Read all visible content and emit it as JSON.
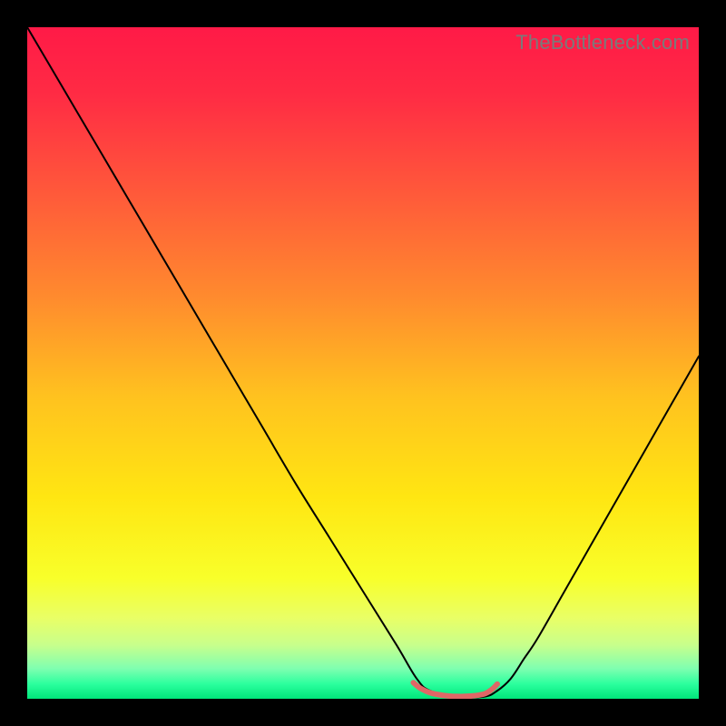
{
  "watermark": "TheBottleneck.com",
  "chart_data": {
    "type": "line",
    "title": "",
    "xlabel": "",
    "ylabel": "",
    "xlim": [
      0,
      100
    ],
    "ylim": [
      0,
      100
    ],
    "grid": false,
    "legend": false,
    "gradient_stops": [
      {
        "offset": 0.0,
        "color": "#ff1a47"
      },
      {
        "offset": 0.1,
        "color": "#ff2b44"
      },
      {
        "offset": 0.25,
        "color": "#ff5a3a"
      },
      {
        "offset": 0.4,
        "color": "#ff8a2e"
      },
      {
        "offset": 0.55,
        "color": "#ffc21f"
      },
      {
        "offset": 0.7,
        "color": "#ffe612"
      },
      {
        "offset": 0.82,
        "color": "#f8ff2a"
      },
      {
        "offset": 0.88,
        "color": "#e9ff66"
      },
      {
        "offset": 0.92,
        "color": "#c8ff8c"
      },
      {
        "offset": 0.955,
        "color": "#7fffb0"
      },
      {
        "offset": 0.978,
        "color": "#2bff9e"
      },
      {
        "offset": 1.0,
        "color": "#00e67a"
      }
    ],
    "series": [
      {
        "name": "bottleneck-curve",
        "color": "#000000",
        "width": 2,
        "x": [
          0,
          5,
          10,
          15,
          20,
          25,
          30,
          35,
          40,
          45,
          50,
          55,
          58,
          60,
          64,
          68,
          70,
          72,
          74,
          76,
          80,
          84,
          88,
          92,
          96,
          100
        ],
        "y": [
          100,
          91.5,
          83,
          74.5,
          66,
          57.5,
          49,
          40.5,
          32,
          24,
          16,
          8,
          3,
          1.2,
          0.3,
          0.3,
          1.2,
          3,
          6,
          9,
          16,
          23,
          30,
          37,
          44,
          51
        ]
      },
      {
        "name": "sweet-spot-band",
        "color": "#e06666",
        "width": 6,
        "x": [
          57.5,
          58.5,
          60,
          62,
          64,
          66,
          68,
          69.2,
          70.0
        ],
        "y": [
          2.4,
          1.6,
          0.9,
          0.5,
          0.35,
          0.4,
          0.7,
          1.4,
          2.2
        ]
      }
    ]
  }
}
